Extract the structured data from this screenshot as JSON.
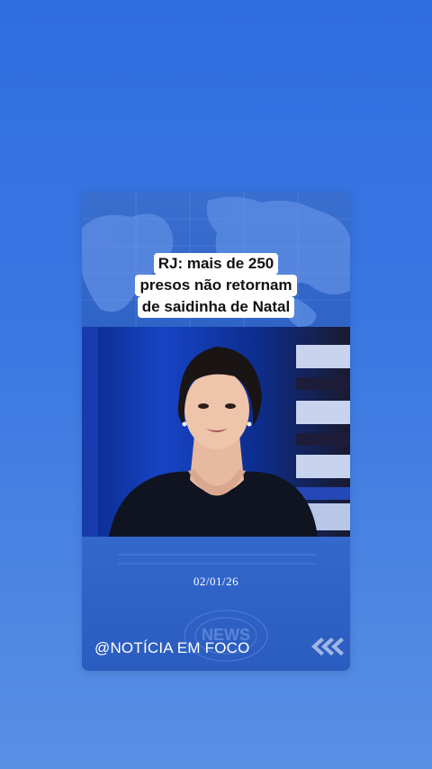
{
  "headline": {
    "line1": "RJ: mais de 250",
    "line2": "presos não retornam",
    "line3": "de saidinha de Natal"
  },
  "date": "02/01/26",
  "handle": "@NOTÍCIA EM FOCO",
  "watermark": "NEWS",
  "colors": {
    "background": "#3a78e2",
    "card": "#2a5fc4",
    "headline_bg": "#ffffff",
    "headline_text": "#111111"
  }
}
